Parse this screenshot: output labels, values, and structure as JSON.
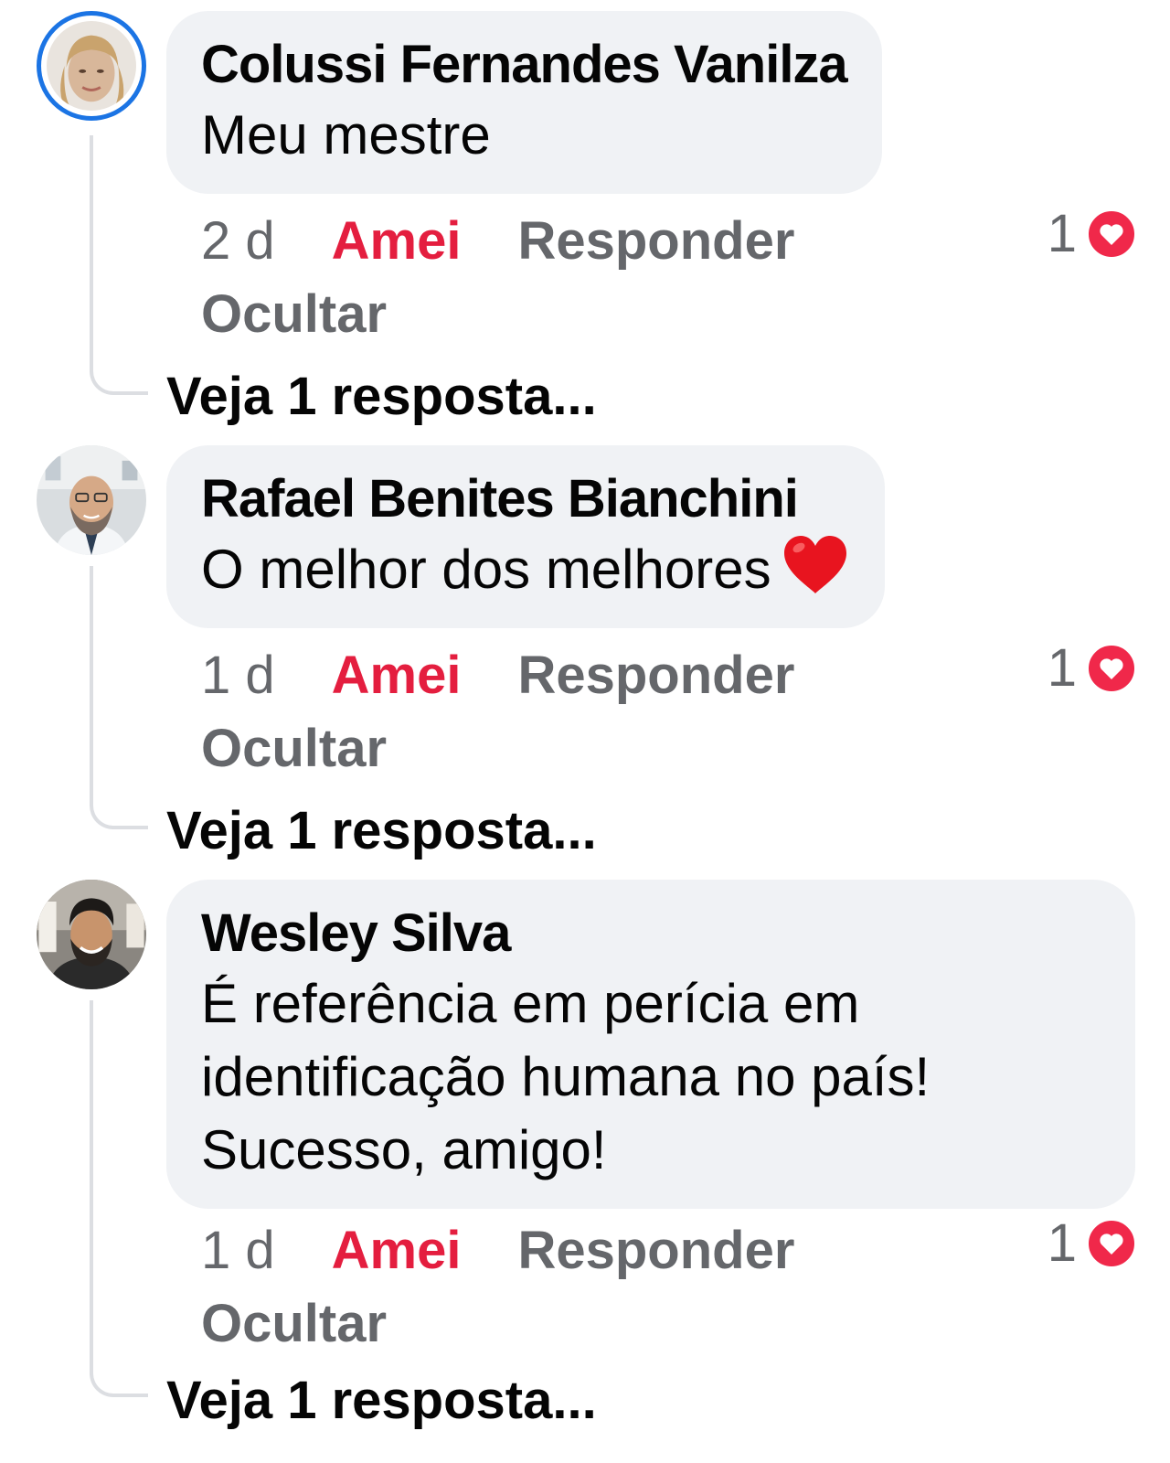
{
  "comments": [
    {
      "author": "Colussi Fernandes Vanilza",
      "text_lines": [
        "Meu mestre"
      ],
      "time": "2 d",
      "amei_label": "Amei",
      "reply_label": "Responder",
      "hide_label": "Ocultar",
      "reaction_count": "1",
      "see_replies": "Veja 1 resposta..."
    },
    {
      "author": "Rafael Benites Bianchini",
      "text_lines": [
        "O melhor dos melhores"
      ],
      "time": "1 d",
      "amei_label": "Amei",
      "reply_label": "Responder",
      "hide_label": "Ocultar",
      "reaction_count": "1",
      "see_replies": "Veja 1 resposta..."
    },
    {
      "author": "Wesley Silva",
      "text_lines": [
        "É referência em perícia em",
        "identificação humana no país!",
        "Sucesso, amigo!"
      ],
      "time": "1 d",
      "amei_label": "Amei",
      "reply_label": "Responder",
      "hide_label": "Ocultar",
      "reaction_count": "1",
      "see_replies": "Veja 1 resposta..."
    }
  ],
  "colors": {
    "bubble_bg": "#f0f2f5",
    "action_gray": "#65676b",
    "amei_red": "#e41e3f",
    "story_ring_blue": "#1b74e4",
    "thread_line": "#dcdee2"
  },
  "icons": {
    "reaction": "love-reaction-icon",
    "emoji": "red-heart-emoji"
  }
}
